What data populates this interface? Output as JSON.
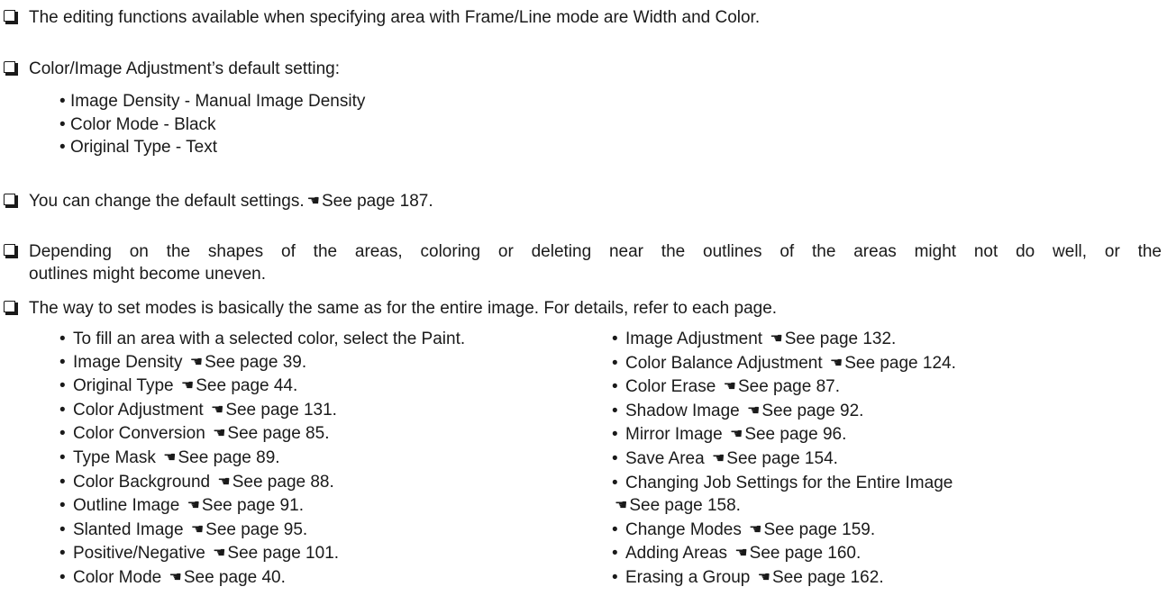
{
  "notes": {
    "n1": "The editing functions available when specifying area with Frame/Line mode are Width and Color.",
    "n2": "Color/Image Adjustment’s default setting:",
    "n3_lead": "You can change the default settings.",
    "n3_ref": "See page 187.",
    "n4_line1": "Depending on the shapes of the areas, coloring or deleting near the outlines of the areas might not do well, or the",
    "n4_line2": "outlines might become uneven.",
    "n5": "The way to set modes is basically the same as for the entire image. For details, refer to each page."
  },
  "defaults": [
    "Image Density - Manual Image Density",
    "Color Mode - Black",
    "Original Type - Text"
  ],
  "bullet": "•",
  "pointer_glyph": "☚",
  "left_column": [
    {
      "label": "To fill an area with a selected color, select the Paint.",
      "ref": ""
    },
    {
      "label": "Image Density",
      "ref": "See page 39."
    },
    {
      "label": "Original Type",
      "ref": "See page 44."
    },
    {
      "label": "Color Adjustment",
      "ref": "See page 131."
    },
    {
      "label": "Color Conversion",
      "ref": "See page 85."
    },
    {
      "label": "Type Mask",
      "ref": "See page 89."
    },
    {
      "label": "Color Background",
      "ref": "See page 88."
    },
    {
      "label": "Outline Image",
      "ref": "See page 91."
    },
    {
      "label": "Slanted Image",
      "ref": "See page 95."
    },
    {
      "label": "Positive/Negative",
      "ref": "See page 101."
    },
    {
      "label": "Color Mode",
      "ref": "See page 40."
    }
  ],
  "right_column": [
    {
      "label": "Image Adjustment",
      "ref": "See page 132."
    },
    {
      "label": "Color Balance Adjustment",
      "ref": "See page 124."
    },
    {
      "label": "Color Erase",
      "ref": "See page 87."
    },
    {
      "label": "Shadow Image",
      "ref": "See page 92."
    },
    {
      "label": "Mirror Image",
      "ref": "See page 96."
    },
    {
      "label": "Save Area",
      "ref": "See page 154."
    },
    {
      "label": "Changing Job Settings for the Entire Image",
      "ref": "See page 158.",
      "wrap": true
    },
    {
      "label": "Change Modes",
      "ref": "See page 159."
    },
    {
      "label": "Adding Areas",
      "ref": "See page 160."
    },
    {
      "label": "Erasing a Group",
      "ref": "See page 162."
    }
  ]
}
